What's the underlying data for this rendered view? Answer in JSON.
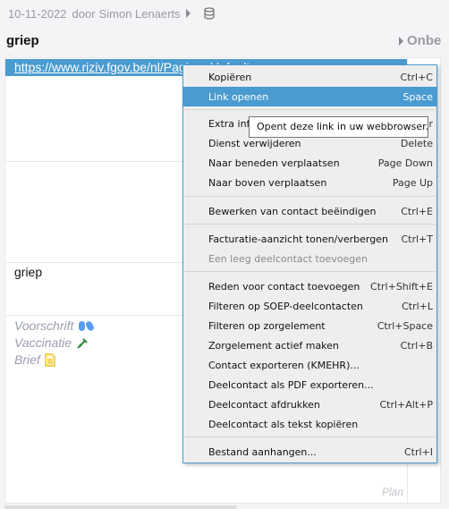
{
  "header": {
    "date": "10-11-2022",
    "by": "door",
    "author": "Simon Lenaerts"
  },
  "title": "griep",
  "right_title": "Onbe",
  "content": {
    "link": "https://www.riziv.fgov.be/nl/Paginas/default.aspx",
    "text": "griep",
    "links": [
      {
        "label": "Voorschrift",
        "icon": "pills-icon"
      },
      {
        "label": "Vaccinatie",
        "icon": "syringe-icon"
      },
      {
        "label": "Brief",
        "icon": "document-icon"
      }
    ],
    "plan": "Plan"
  },
  "menu": {
    "items": [
      {
        "label": "Kopiëren",
        "shortcut": "Ctrl+C"
      },
      {
        "label": "Link openen",
        "shortcut": "Space",
        "highlighted": true
      },
      {
        "label": "Extra info",
        "shortcut": "Ctrl+Shift+Enter"
      },
      {
        "label": "Dienst verwijderen",
        "shortcut": "Delete"
      },
      {
        "label": "Naar beneden verplaatsen",
        "shortcut": "Page Down"
      },
      {
        "label": "Naar boven verplaatsen",
        "shortcut": "Page Up"
      },
      {
        "label": "Bewerken van contact beëindigen",
        "shortcut": "Ctrl+E"
      },
      {
        "label": "Facturatie-aanzicht tonen/verbergen",
        "shortcut": "Ctrl+T"
      },
      {
        "label": "Een leeg deelcontact toevoegen",
        "shortcut": "",
        "disabled": true
      },
      {
        "label": "Reden voor contact toevoegen",
        "shortcut": "Ctrl+Shift+E"
      },
      {
        "label": "Filteren op SOEP-deelcontacten",
        "shortcut": "Ctrl+L"
      },
      {
        "label": "Filteren op zorgelement",
        "shortcut": "Ctrl+Space"
      },
      {
        "label": "Zorgelement actief maken",
        "shortcut": "Ctrl+B"
      },
      {
        "label": "Contact exporteren (KMEHR)...",
        "shortcut": ""
      },
      {
        "label": "Deelcontact als PDF exporteren...",
        "shortcut": ""
      },
      {
        "label": "Deelcontact afdrukken",
        "shortcut": "Ctrl+Alt+P"
      },
      {
        "label": "Deelcontact als tekst kopiëren",
        "shortcut": ""
      },
      {
        "label": "Bestand aanhangen...",
        "shortcut": "Ctrl+I"
      }
    ]
  },
  "tooltip": "Opent deze link in uw webbrowser.",
  "colors": {
    "accent": "#4a9bd0",
    "menu_bg": "#eeeeee"
  }
}
